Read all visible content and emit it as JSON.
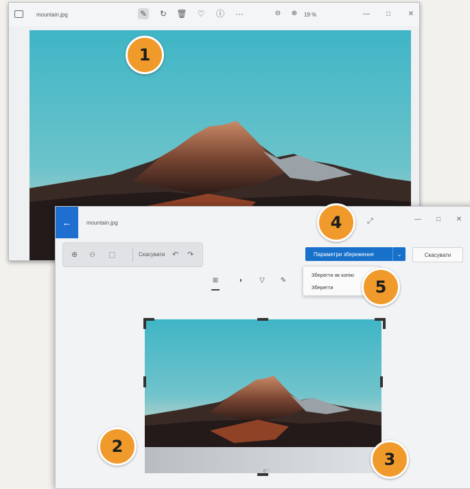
{
  "viewer": {
    "filename": "mountain.jpg",
    "zoom": "19 %",
    "toolbar_icons": [
      "edit-image-icon",
      "rotate-icon",
      "delete-icon",
      "favorite-icon",
      "info-icon",
      "more-icon"
    ]
  },
  "editor": {
    "filename": "mountain.jpg",
    "undo_label": "Скасувати",
    "save_options_label": "Параметри збереження",
    "cancel_label": "Скасувати",
    "menu_items": [
      "Зберегти як копію",
      "Зберегти"
    ],
    "tool_tabs": [
      "crop-icon",
      "adjust-icon",
      "filter-icon",
      "markup-icon"
    ],
    "angle": "0 °"
  },
  "callouts": [
    "1",
    "2",
    "3",
    "4",
    "5"
  ],
  "colors": {
    "accent": "#1770c9",
    "callout": "#f19a2c",
    "back_button": "#1f6fd1"
  }
}
